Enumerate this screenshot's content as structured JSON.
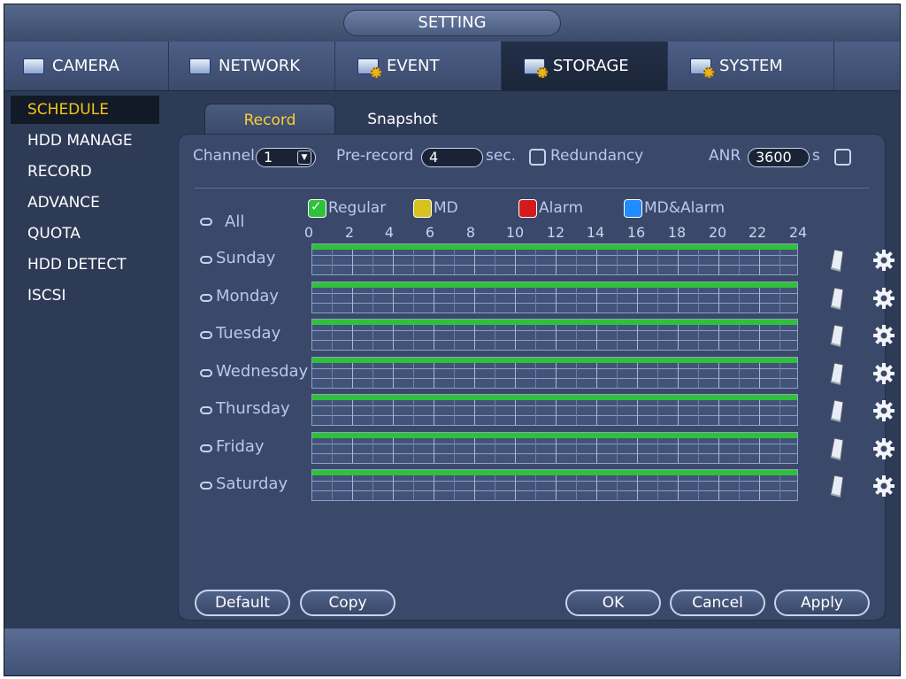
{
  "window": {
    "title": "SETTING"
  },
  "main_tabs": [
    {
      "label": "CAMERA",
      "icon": "camera-icon"
    },
    {
      "label": "NETWORK",
      "icon": "network-icon"
    },
    {
      "label": "EVENT",
      "icon": "event-icon"
    },
    {
      "label": "STORAGE",
      "icon": "storage-icon",
      "active": true
    },
    {
      "label": "SYSTEM",
      "icon": "system-icon"
    }
  ],
  "sidebar": {
    "items": [
      {
        "label": "SCHEDULE",
        "active": true
      },
      {
        "label": "HDD MANAGE"
      },
      {
        "label": "RECORD"
      },
      {
        "label": "ADVANCE"
      },
      {
        "label": "QUOTA"
      },
      {
        "label": "HDD DETECT"
      },
      {
        "label": "ISCSI"
      }
    ]
  },
  "sub_tabs": [
    {
      "label": "Record",
      "active": true
    },
    {
      "label": "Snapshot"
    }
  ],
  "settings": {
    "channel_label": "Channel",
    "channel_value": "1",
    "prerecord_label": "Pre-record",
    "prerecord_value": "4",
    "prerecord_unit": "sec.",
    "redundancy_label": "Redundancy",
    "anr_label": "ANR",
    "anr_value": "3600",
    "anr_unit": "s"
  },
  "legend": {
    "regular": {
      "label": "Regular",
      "color": "#2ec13a"
    },
    "md": {
      "label": "MD",
      "color": "#d8c21e"
    },
    "alarm": {
      "label": "Alarm",
      "color": "#d41a1a"
    },
    "md_alarm": {
      "label": "MD&Alarm",
      "color": "#1f8cff"
    }
  },
  "schedule": {
    "all_label": "All",
    "hours": [
      "0",
      "2",
      "4",
      "6",
      "8",
      "10",
      "12",
      "14",
      "16",
      "18",
      "20",
      "22",
      "24"
    ],
    "days": [
      "Sunday",
      "Monday",
      "Tuesday",
      "Wednesday",
      "Thursday",
      "Friday",
      "Saturday"
    ],
    "day_record_type": "Regular",
    "day_record_start_hour": 0,
    "day_record_end_hour": 24
  },
  "buttons": {
    "default": "Default",
    "copy": "Copy",
    "ok": "OK",
    "cancel": "Cancel",
    "apply": "Apply"
  },
  "colors": {
    "active_text": "#f5c518",
    "regular": "#2ec13a"
  }
}
